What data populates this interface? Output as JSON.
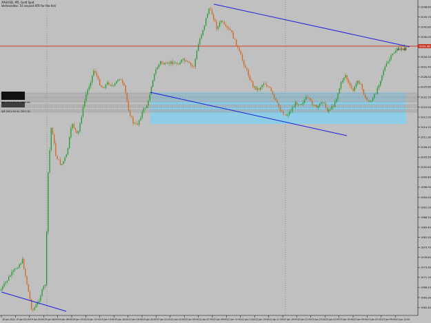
{
  "window": {
    "symbol_line": "XAUUSD, M5, Gold Spot",
    "indicator_line": "Vertexindex: 10 second ATR for the tick"
  },
  "colors": {
    "background": "#c0c0c0",
    "bull_candle": "#1f9a2a",
    "bear_candle": "#d0651c",
    "trendline": "#1c1ce0",
    "resistance_line": "#c83c2a",
    "zone_fill": "#87ceeb",
    "price_tag_bg": "#c83c2a",
    "price_tag_text": "#ffffff"
  },
  "price_axis": {
    "labels": [
      "2048.60",
      "2045.70",
      "2042.80",
      "2040.00",
      "2037.10",
      "2034.20",
      "2031.40",
      "2028.50",
      "2025.60",
      "2022.70",
      "2019.90",
      "2017.00",
      "2014.10",
      "2011.30",
      "2008.40",
      "2005.50",
      "2002.60",
      "1999.80",
      "1996.90",
      "1994.00",
      "1991.20",
      "1988.30",
      "1985.40",
      "1982.50",
      "1979.70",
      "1976.80",
      "1973.90",
      "1971.10",
      "1968.20",
      "1965.30",
      "1962.40"
    ],
    "current_price": "2032.48"
  },
  "time_axis": {
    "labels": [
      "18 Jan 2024",
      "19 Jan 02:00",
      "19 Jan 04:00",
      "19 Jan 06:00",
      "19 Jan 08:00",
      "19 Jan 10:00",
      "19 Jan 12:00",
      "19 Jan 14:00",
      "19 Jan 16:00",
      "19 Jan 18:00",
      "19 Jan 20:00",
      "22 Jan 01:00",
      "22 Jan 03:00",
      "22 Jan 05:00",
      "22 Jan 07:00",
      "22 Jan 09:00",
      "22 Jan 11:00",
      "22 Jan 13:00",
      "22 Jan 15:00",
      "22 Jan 17:00",
      "22 Jan 19:00",
      "22 Jan 21:00",
      "22 Jan 23:00",
      "23 Jan 01:00",
      "23 Jan 03:00",
      "23 Jan 05:00",
      "23 Jan 07:00",
      "23 Jan 09:00",
      "23 Jan 11:00"
    ]
  },
  "level_labels": {
    "upper": "S/R 2025.20  H1 2024.60",
    "lower": "S/R 2021.90  H1 2021.30"
  },
  "annotation": "2032.48"
}
